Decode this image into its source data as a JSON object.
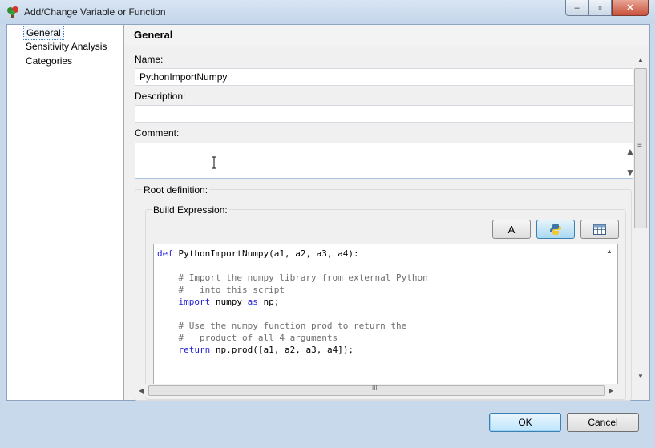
{
  "window": {
    "title": "Add/Change Variable or Function",
    "minimize_symbol": "–",
    "restore_symbol": "▫",
    "close_symbol": "✕"
  },
  "nav": {
    "items": [
      "General",
      "Sensitivity Analysis",
      "Categories"
    ],
    "selected": "General"
  },
  "main": {
    "title": "General",
    "name_label": "Name:",
    "name_value": "PythonImportNumpy",
    "description_label": "Description:",
    "description_value": "",
    "comment_label": "Comment:",
    "comment_value": "",
    "root_definition_label": "Root definition:",
    "build_expression_label": "Build Expression:",
    "toolbar": {
      "text_mode_label": "A",
      "python_mode_icon": "python-logo-icon",
      "table_mode_icon": "table-icon",
      "active": "python"
    }
  },
  "code_lines": [
    [
      {
        "t": "def",
        "c": "kw"
      },
      {
        "t": " PythonImportNumpy(a1, a2, a3, a4):",
        "c": ""
      }
    ],
    [
      {
        "t": "",
        "c": ""
      }
    ],
    [
      {
        "t": "    # Import the numpy library from external Python",
        "c": "cm"
      }
    ],
    [
      {
        "t": "    #   into this script",
        "c": "cm"
      }
    ],
    [
      {
        "t": "    ",
        "c": ""
      },
      {
        "t": "import",
        "c": "kw"
      },
      {
        "t": " numpy ",
        "c": ""
      },
      {
        "t": "as",
        "c": "kw"
      },
      {
        "t": " np;",
        "c": ""
      }
    ],
    [
      {
        "t": "",
        "c": ""
      }
    ],
    [
      {
        "t": "    # Use the numpy function prod to return the",
        "c": "cm"
      }
    ],
    [
      {
        "t": "    #   product of all 4 arguments",
        "c": "cm"
      }
    ],
    [
      {
        "t": "    ",
        "c": ""
      },
      {
        "t": "return",
        "c": "kw"
      },
      {
        "t": " np.prod([a1, a2, a3, a4]);",
        "c": ""
      }
    ]
  ],
  "buttons": {
    "ok": "OK",
    "cancel": "Cancel"
  },
  "scroll_glyphs": {
    "up": "▲",
    "down": "▼",
    "left": "◀",
    "right": "▶",
    "grip_h": "III",
    "grip_v": "≡"
  },
  "colors": {
    "keyword": "#1f1fd6",
    "comment": "#6e6e6e",
    "selection_border": "#4a7fc2"
  }
}
